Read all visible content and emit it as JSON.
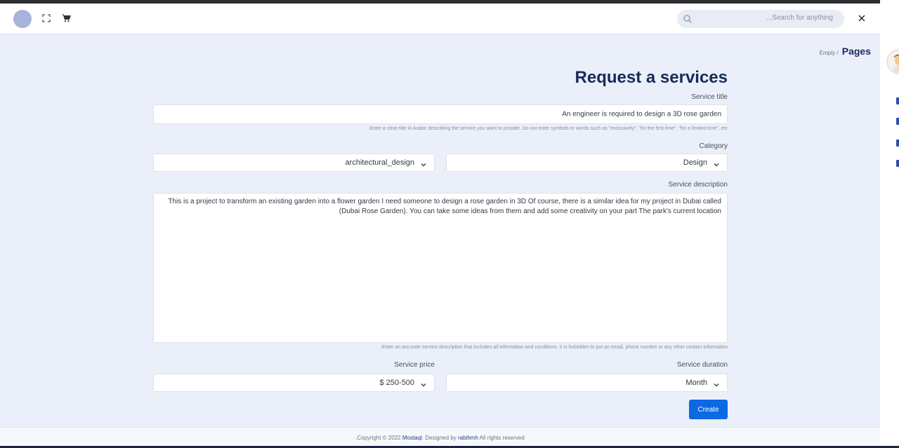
{
  "header": {
    "fullscreen_icon": "fullscreen-icon",
    "cart_icon": "cart-icon",
    "search_placeholder": "...Search for anything",
    "close_icon": "close-icon"
  },
  "breadcrumb": {
    "parent": "Empty /",
    "current": "Pages"
  },
  "form": {
    "title": "Request a services",
    "service_title": {
      "label": "Service title",
      "value": "An engineer is required to design a 3D rose garden",
      "help": ".Enter a clear title in Arabic describing the service you want to provide. Do not enter symbols or words such as \"exclusively\", \"for the first time\", \"for a limited time\", etc"
    },
    "category": {
      "label": "Category",
      "primary_value": "Design",
      "sub_value": "architectural_design"
    },
    "description": {
      "label": "Service description",
      "value": "This is a project to transform an existing garden into a flower garden I need someone to design a rose garden in 3D Of course, there is a similar idea for my project in Dubai called (Dubai Rose Garden). You can take some ideas from them and add some creativity on your part The park's current location",
      "help": ".Enter an accurate service description that includes all information and conditions. It is forbidden to put an email, phone number or any other contact information"
    },
    "duration": {
      "label": "Service duration",
      "value": "Month"
    },
    "price": {
      "label": "Service price",
      "value": "$ 250-500"
    },
    "create_label": "Create"
  },
  "footer": {
    "prefix": ".Copyright © 2022 ",
    "brand": "Mostaql",
    "middle": ". Designed by ",
    "designer": "rabihmh",
    "suffix": " All rights reserved"
  },
  "colors": {
    "accent": "#0b69e3",
    "background": "#eaeff9",
    "title": "#172b5a"
  }
}
